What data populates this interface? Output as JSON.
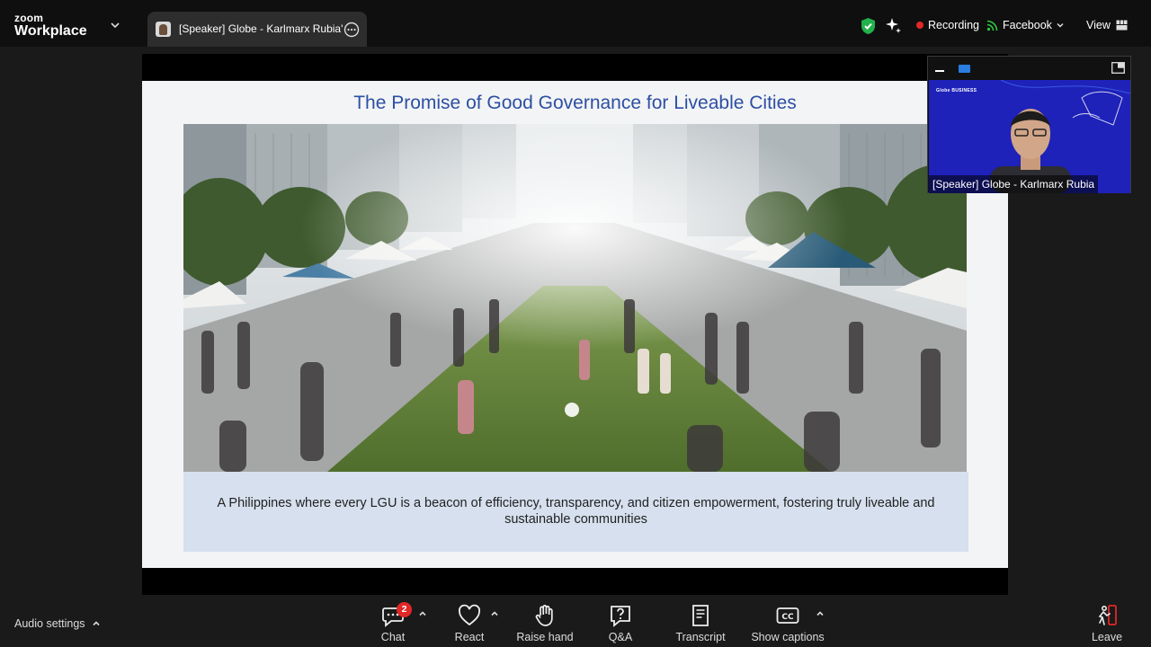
{
  "app": {
    "brand_top": "zoom",
    "brand_bottom": "Workplace"
  },
  "tab": {
    "title": "[Speaker] Globe - Karlmarx Rubia'"
  },
  "status": {
    "recording": "Recording",
    "live_stream": "Facebook",
    "view": "View"
  },
  "slide": {
    "title": "The Promise of Good Governance for Liveable Cities",
    "caption": "A Philippines where every LGU is a beacon of efficiency, transparency, and citizen empowerment, fostering truly liveable and sustainable communities"
  },
  "speaker_thumb": {
    "logo_text": "Globe BUSINESS",
    "name": "[Speaker] Globe - Karlmarx Rubia"
  },
  "toolbar": {
    "audio_settings": "Audio settings",
    "chat_label": "Chat",
    "chat_badge": "2",
    "react_label": "React",
    "raise_hand_label": "Raise hand",
    "qa_label": "Q&A",
    "transcript_label": "Transcript",
    "captions_label": "Show captions",
    "leave_label": "Leave"
  },
  "colors": {
    "accent": "#2a7de1",
    "record": "#e02828",
    "live": "#2ecc40",
    "title_blue": "#2d4fa2",
    "caption_bg": "#d6e0ee",
    "thumb_bg": "#1e22b9"
  },
  "icons": [
    "chevron-down-icon",
    "avatar-icon",
    "more-icon",
    "shield-check-icon",
    "sparkle-icon",
    "record-dot-icon",
    "live-stream-icon",
    "grid-view-icon",
    "minimize-icon",
    "camera-icon",
    "layout-icon",
    "chevron-up-icon",
    "chat-icon",
    "heart-icon",
    "hand-icon",
    "question-icon",
    "transcript-icon",
    "cc-icon",
    "leave-icon"
  ]
}
